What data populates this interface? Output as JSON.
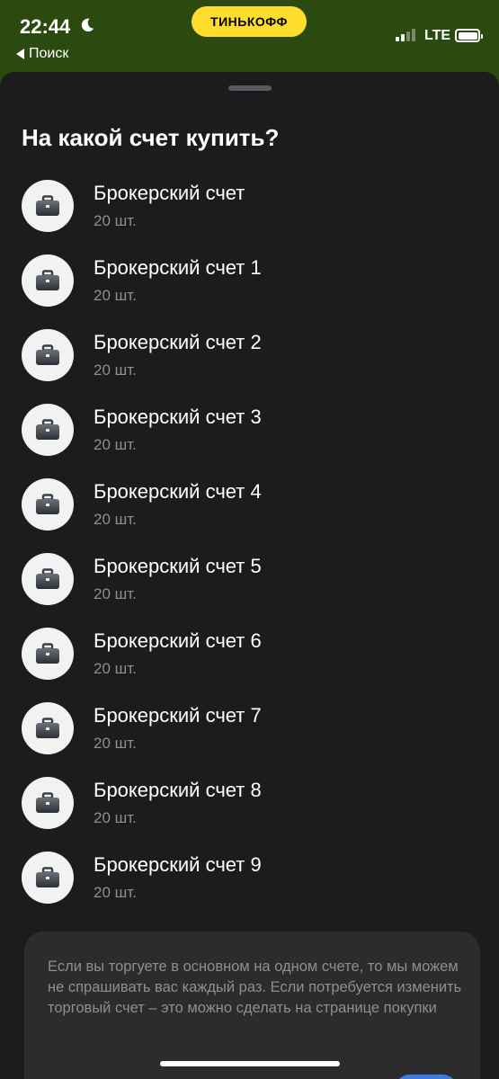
{
  "status": {
    "time": "22:44",
    "back_label": "Поиск",
    "brand": "ТИНЬКОФФ",
    "network": "LTE"
  },
  "sheet": {
    "title": "На какой счет купить?",
    "accounts": [
      {
        "name": "Брокерский счет",
        "quantity": "20 шт.",
        "icon": "briefcase-icon"
      },
      {
        "name": "Брокерский счет 1",
        "quantity": "20 шт.",
        "icon": "briefcase-icon"
      },
      {
        "name": "Брокерский счет 2",
        "quantity": "20 шт.",
        "icon": "briefcase-icon"
      },
      {
        "name": "Брокерский счет 3",
        "quantity": "20 шт.",
        "icon": "briefcase-icon"
      },
      {
        "name": "Брокерский счет 4",
        "quantity": "20 шт.",
        "icon": "briefcase-icon"
      },
      {
        "name": "Брокерский счет 5",
        "quantity": "20 шт.",
        "icon": "briefcase-icon"
      },
      {
        "name": "Брокерский счет 6",
        "quantity": "20 шт.",
        "icon": "briefcase-icon"
      },
      {
        "name": "Брокерский счет 7",
        "quantity": "20 шт.",
        "icon": "briefcase-icon"
      },
      {
        "name": "Брокерский счет 8",
        "quantity": "20 шт.",
        "icon": "briefcase-icon"
      },
      {
        "name": "Брокерский счет 9",
        "quantity": "20 шт.",
        "icon": "briefcase-icon"
      }
    ],
    "info_text": "Если вы торгуете в основном на одном счете, то мы можем не спрашивать вас каждый раз. Если потребуется изменить торговый счет – это можно сделать на странице покупки"
  },
  "colors": {
    "status_bg": "#2a4a10",
    "sheet_bg": "#1c1c1e",
    "brand_yellow": "#ffdd2d",
    "secondary_text": "#8e8e93",
    "card_bg": "#2c2c2e",
    "toggle_blue": "#3d7be0"
  }
}
